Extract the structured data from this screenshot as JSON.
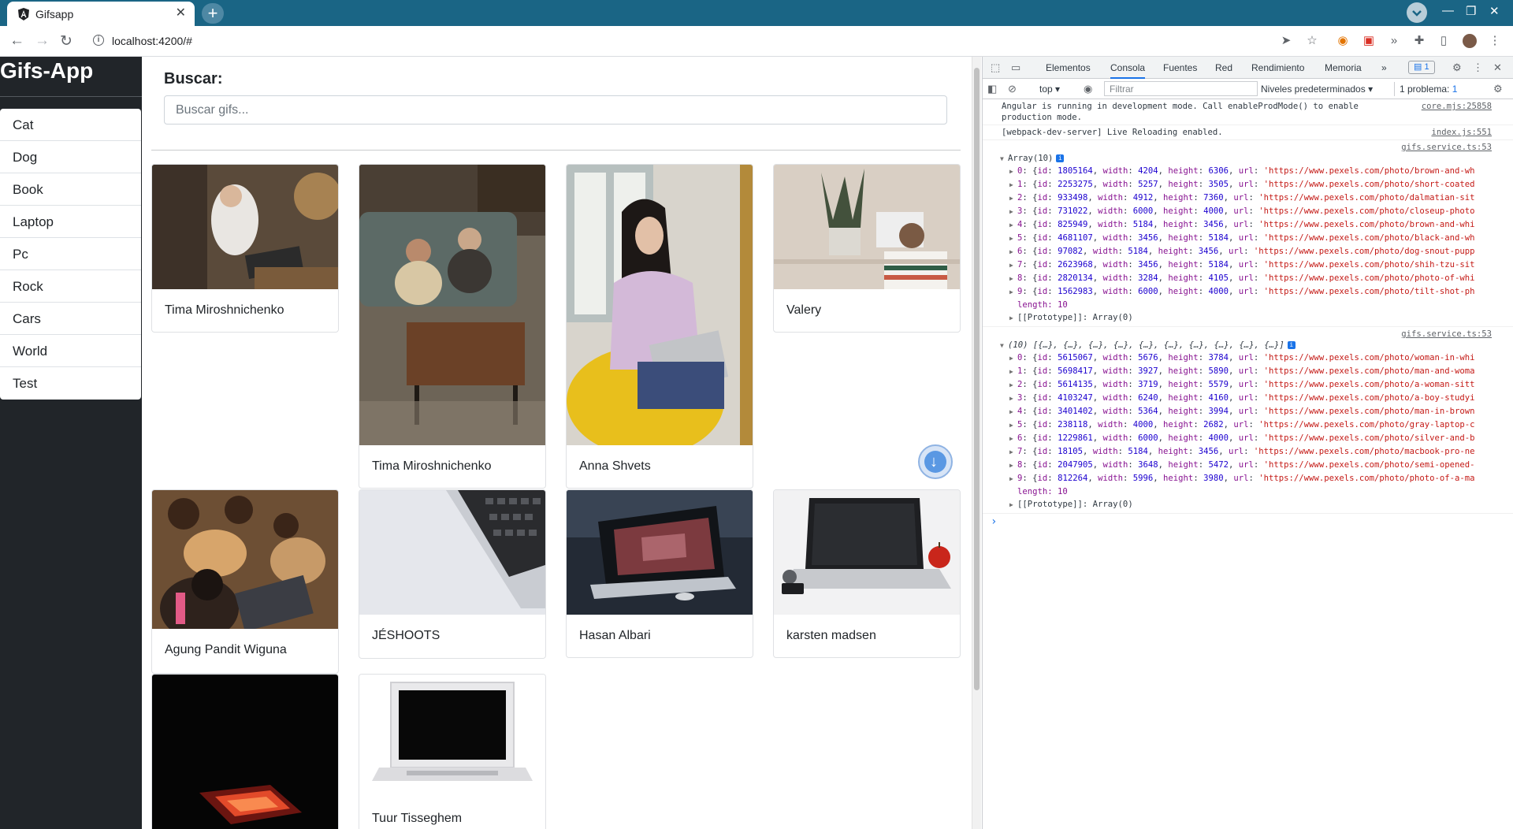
{
  "browser": {
    "tab_title": "Gifsapp",
    "tab_close": "✕",
    "new_tab": "+",
    "url": "localhost:4200/#"
  },
  "app": {
    "brand": "Gifs-App",
    "history": [
      "Cat",
      "Dog",
      "Book",
      "Laptop",
      "Pc",
      "Rock",
      "Cars",
      "World",
      "Test"
    ],
    "search_label": "Buscar:",
    "search_placeholder": "Buscar gifs...",
    "cards": [
      {
        "caption": "Tima Miroshnichenko",
        "icon": "person-laptop-photo"
      },
      {
        "caption": "Tima Miroshnichenko",
        "icon": "couple-sofa-photo"
      },
      {
        "caption": "Anna Shvets",
        "icon": "woman-laptop-photo"
      },
      {
        "caption": "Valery",
        "icon": "desk-plant-photo"
      },
      {
        "caption": "Agung Pandit Wiguna",
        "icon": "kids-laptop-photo"
      },
      {
        "caption": "JÉSHOOTS",
        "icon": "keyboard-photo"
      },
      {
        "caption": "Hasan Albari",
        "icon": "dark-laptop-photo"
      },
      {
        "caption": "karsten madsen",
        "icon": "laptop-apple-photo"
      },
      {
        "caption": "",
        "icon": "red-laptop-photo"
      },
      {
        "caption": "Tuur Tisseghem",
        "icon": "white-laptop-photo"
      }
    ]
  },
  "devtools": {
    "tabs": [
      "Elementos",
      "Consola",
      "Fuentes",
      "Red",
      "Rendimiento",
      "Memoria",
      "»"
    ],
    "issues_count": "1",
    "context": "top ▾",
    "filter_placeholder": "Filtrar",
    "levels": "Niveles predeterminados ▾",
    "problems": "1 problema: ",
    "problems_count": "1",
    "messages": [
      {
        "text": "Angular is running in development mode. Call enableProdMode() to enable production mode.",
        "src": "core.mjs:25858"
      },
      {
        "text": "[webpack-dev-server] Live Reloading enabled.",
        "src": "index.js:551"
      }
    ],
    "log1": {
      "src": "gifs.service.ts:53",
      "head": "Array(10)",
      "rows": [
        {
          "i": "0",
          "id": "1805164",
          "w": "4204",
          "h": "6306",
          "url": "'https://www.pexels.com/photo/brown-and-wh"
        },
        {
          "i": "1",
          "id": "2253275",
          "w": "5257",
          "h": "3505",
          "url": "'https://www.pexels.com/photo/short-coated"
        },
        {
          "i": "2",
          "id": "933498",
          "w": "4912",
          "h": "7360",
          "url": "'https://www.pexels.com/photo/dalmatian-sit"
        },
        {
          "i": "3",
          "id": "731022",
          "w": "6000",
          "h": "4000",
          "url": "'https://www.pexels.com/photo/closeup-photo"
        },
        {
          "i": "4",
          "id": "825949",
          "w": "5184",
          "h": "3456",
          "url": "'https://www.pexels.com/photo/brown-and-whi"
        },
        {
          "i": "5",
          "id": "4681107",
          "w": "3456",
          "h": "5184",
          "url": "'https://www.pexels.com/photo/black-and-wh"
        },
        {
          "i": "6",
          "id": "97082",
          "w": "5184",
          "h": "3456",
          "url": "'https://www.pexels.com/photo/dog-snout-pupp"
        },
        {
          "i": "7",
          "id": "2623968",
          "w": "3456",
          "h": "5184",
          "url": "'https://www.pexels.com/photo/shih-tzu-sit"
        },
        {
          "i": "8",
          "id": "2820134",
          "w": "3284",
          "h": "4105",
          "url": "'https://www.pexels.com/photo/photo-of-whi"
        },
        {
          "i": "9",
          "id": "1562983",
          "w": "6000",
          "h": "4000",
          "url": "'https://www.pexels.com/photo/tilt-shot-ph"
        }
      ],
      "length": "length: 10",
      "proto": "[[Prototype]]: Array(0)"
    },
    "log2": {
      "src": "gifs.service.ts:53",
      "head": "(10) [{…}, {…}, {…}, {…}, {…}, {…}, {…}, {…}, {…}, {…}]",
      "rows": [
        {
          "i": "0",
          "id": "5615067",
          "w": "5676",
          "h": "3784",
          "url": "'https://www.pexels.com/photo/woman-in-whi"
        },
        {
          "i": "1",
          "id": "5698417",
          "w": "3927",
          "h": "5890",
          "url": "'https://www.pexels.com/photo/man-and-woma"
        },
        {
          "i": "2",
          "id": "5614135",
          "w": "3719",
          "h": "5579",
          "url": "'https://www.pexels.com/photo/a-woman-sitt"
        },
        {
          "i": "3",
          "id": "4103247",
          "w": "6240",
          "h": "4160",
          "url": "'https://www.pexels.com/photo/a-boy-studyi"
        },
        {
          "i": "4",
          "id": "3401402",
          "w": "5364",
          "h": "3994",
          "url": "'https://www.pexels.com/photo/man-in-brown"
        },
        {
          "i": "5",
          "id": "238118",
          "w": "4000",
          "h": "2682",
          "url": "'https://www.pexels.com/photo/gray-laptop-c"
        },
        {
          "i": "6",
          "id": "1229861",
          "w": "6000",
          "h": "4000",
          "url": "'https://www.pexels.com/photo/silver-and-b"
        },
        {
          "i": "7",
          "id": "18105",
          "w": "5184",
          "h": "3456",
          "url": "'https://www.pexels.com/photo/macbook-pro-ne"
        },
        {
          "i": "8",
          "id": "2047905",
          "w": "3648",
          "h": "5472",
          "url": "'https://www.pexels.com/photo/semi-opened-"
        },
        {
          "i": "9",
          "id": "812264",
          "w": "5996",
          "h": "3980",
          "url": "'https://www.pexels.com/photo/photo-of-a-ma"
        }
      ],
      "length": "length: 10",
      "proto": "[[Prototype]]: Array(0)"
    },
    "prompt": "›"
  }
}
